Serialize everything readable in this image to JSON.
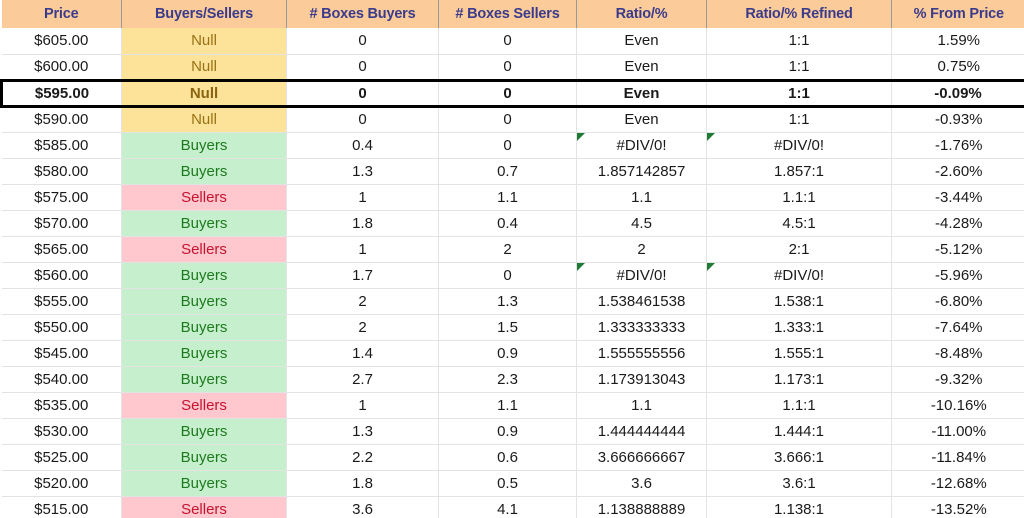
{
  "table": {
    "columns": [
      "Price",
      "Buyers/Sellers",
      "# Boxes Buyers",
      "# Boxes Sellers",
      "Ratio/%",
      "Ratio/% Refined",
      "% From Price"
    ],
    "colors": {
      "header_bg": "#FBCB99",
      "header_text": "#3B3B8C",
      "null_bg": "#FCE399",
      "null_text": "#9A7215",
      "buyers_bg": "#C6EFCE",
      "buyers_text": "#1D7A1D",
      "sellers_bg": "#FFC7CE",
      "sellers_text": "#C4142F",
      "grid_line": "#E3E3E3",
      "selected_border": "#000000",
      "error_marker": "#1E7A34"
    },
    "rows": [
      {
        "price": "$605.00",
        "status": "Null",
        "status_kind": "null",
        "boxes_buyers": "0",
        "boxes_sellers": "0",
        "ratio": "Even",
        "ratio_refined": "1:1",
        "from_price": "1.59%",
        "selected": false,
        "error": false
      },
      {
        "price": "$600.00",
        "status": "Null",
        "status_kind": "null",
        "boxes_buyers": "0",
        "boxes_sellers": "0",
        "ratio": "Even",
        "ratio_refined": "1:1",
        "from_price": "0.75%",
        "selected": false,
        "error": false
      },
      {
        "price": "$595.00",
        "status": "Null",
        "status_kind": "null",
        "boxes_buyers": "0",
        "boxes_sellers": "0",
        "ratio": "Even",
        "ratio_refined": "1:1",
        "from_price": "-0.09%",
        "selected": true,
        "error": false
      },
      {
        "price": "$590.00",
        "status": "Null",
        "status_kind": "null",
        "boxes_buyers": "0",
        "boxes_sellers": "0",
        "ratio": "Even",
        "ratio_refined": "1:1",
        "from_price": "-0.93%",
        "selected": false,
        "error": false
      },
      {
        "price": "$585.00",
        "status": "Buyers",
        "status_kind": "buy",
        "boxes_buyers": "0.4",
        "boxes_sellers": "0",
        "ratio": "#DIV/0!",
        "ratio_refined": "#DIV/0!",
        "from_price": "-1.76%",
        "selected": false,
        "error": true
      },
      {
        "price": "$580.00",
        "status": "Buyers",
        "status_kind": "buy",
        "boxes_buyers": "1.3",
        "boxes_sellers": "0.7",
        "ratio": "1.857142857",
        "ratio_refined": "1.857:1",
        "from_price": "-2.60%",
        "selected": false,
        "error": false
      },
      {
        "price": "$575.00",
        "status": "Sellers",
        "status_kind": "sell",
        "boxes_buyers": "1",
        "boxes_sellers": "1.1",
        "ratio": "1.1",
        "ratio_refined": "1.1:1",
        "from_price": "-3.44%",
        "selected": false,
        "error": false
      },
      {
        "price": "$570.00",
        "status": "Buyers",
        "status_kind": "buy",
        "boxes_buyers": "1.8",
        "boxes_sellers": "0.4",
        "ratio": "4.5",
        "ratio_refined": "4.5:1",
        "from_price": "-4.28%",
        "selected": false,
        "error": false
      },
      {
        "price": "$565.00",
        "status": "Sellers",
        "status_kind": "sell",
        "boxes_buyers": "1",
        "boxes_sellers": "2",
        "ratio": "2",
        "ratio_refined": "2:1",
        "from_price": "-5.12%",
        "selected": false,
        "error": false
      },
      {
        "price": "$560.00",
        "status": "Buyers",
        "status_kind": "buy",
        "boxes_buyers": "1.7",
        "boxes_sellers": "0",
        "ratio": "#DIV/0!",
        "ratio_refined": "#DIV/0!",
        "from_price": "-5.96%",
        "selected": false,
        "error": true
      },
      {
        "price": "$555.00",
        "status": "Buyers",
        "status_kind": "buy",
        "boxes_buyers": "2",
        "boxes_sellers": "1.3",
        "ratio": "1.538461538",
        "ratio_refined": "1.538:1",
        "from_price": "-6.80%",
        "selected": false,
        "error": false
      },
      {
        "price": "$550.00",
        "status": "Buyers",
        "status_kind": "buy",
        "boxes_buyers": "2",
        "boxes_sellers": "1.5",
        "ratio": "1.333333333",
        "ratio_refined": "1.333:1",
        "from_price": "-7.64%",
        "selected": false,
        "error": false
      },
      {
        "price": "$545.00",
        "status": "Buyers",
        "status_kind": "buy",
        "boxes_buyers": "1.4",
        "boxes_sellers": "0.9",
        "ratio": "1.555555556",
        "ratio_refined": "1.555:1",
        "from_price": "-8.48%",
        "selected": false,
        "error": false
      },
      {
        "price": "$540.00",
        "status": "Buyers",
        "status_kind": "buy",
        "boxes_buyers": "2.7",
        "boxes_sellers": "2.3",
        "ratio": "1.173913043",
        "ratio_refined": "1.173:1",
        "from_price": "-9.32%",
        "selected": false,
        "error": false
      },
      {
        "price": "$535.00",
        "status": "Sellers",
        "status_kind": "sell",
        "boxes_buyers": "1",
        "boxes_sellers": "1.1",
        "ratio": "1.1",
        "ratio_refined": "1.1:1",
        "from_price": "-10.16%",
        "selected": false,
        "error": false
      },
      {
        "price": "$530.00",
        "status": "Buyers",
        "status_kind": "buy",
        "boxes_buyers": "1.3",
        "boxes_sellers": "0.9",
        "ratio": "1.444444444",
        "ratio_refined": "1.444:1",
        "from_price": "-11.00%",
        "selected": false,
        "error": false
      },
      {
        "price": "$525.00",
        "status": "Buyers",
        "status_kind": "buy",
        "boxes_buyers": "2.2",
        "boxes_sellers": "0.6",
        "ratio": "3.666666667",
        "ratio_refined": "3.666:1",
        "from_price": "-11.84%",
        "selected": false,
        "error": false
      },
      {
        "price": "$520.00",
        "status": "Buyers",
        "status_kind": "buy",
        "boxes_buyers": "1.8",
        "boxes_sellers": "0.5",
        "ratio": "3.6",
        "ratio_refined": "3.6:1",
        "from_price": "-12.68%",
        "selected": false,
        "error": false
      },
      {
        "price": "$515.00",
        "status": "Sellers",
        "status_kind": "sell",
        "boxes_buyers": "3.6",
        "boxes_sellers": "4.1",
        "ratio": "1.138888889",
        "ratio_refined": "1.138:1",
        "from_price": "-13.52%",
        "selected": false,
        "error": false
      }
    ]
  }
}
